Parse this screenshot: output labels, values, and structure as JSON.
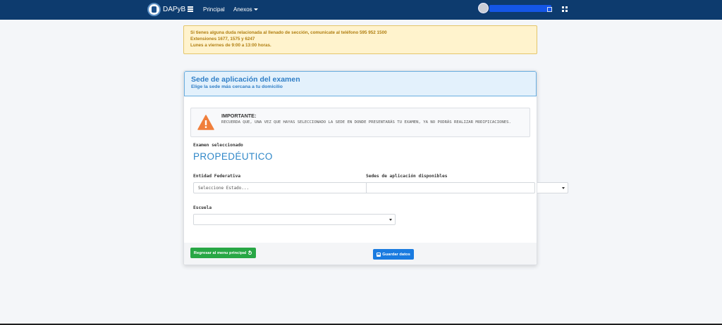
{
  "navbar": {
    "brand": "DAPyB",
    "links": [
      {
        "label": "Principal"
      },
      {
        "label": "Anexos"
      }
    ],
    "icons": {
      "menu": "menu-icon",
      "user": "avatar",
      "expand": "expand-icon",
      "apps": "grid-icon"
    }
  },
  "alert": {
    "line1": "Si tienes alguna duda relacionada al llenado de sección, comunicate al teléfono 595 952 1500",
    "line2": "Extensiones 1677, 1575 y 6247",
    "line3": "Lunes a viernes de 9:00 a 13:00 horas."
  },
  "card": {
    "title": "Sede de aplicación del examen",
    "subtitle": "Elige la sede más cercana a tu domicilio",
    "important": {
      "title": "IMPORTANTE:",
      "text": "RECUERDA QUE, UNA VEZ QUE HAYAS SELECCIONADO LA SEDE EN DONDE PRESENTARÁS TU EXAMEN, YA NO PODRÁS REALIZAR MODIFICACIONES."
    },
    "exam": {
      "label": "Examen seleccionado",
      "value": "PROPEDÉUTICO"
    },
    "form": {
      "entidad_label": "Entidad Federativa",
      "entidad_value": "Seleccione Estado...",
      "sedes_label": "Sedes de aplicación disponibles",
      "sedes_value": "",
      "escuela_label": "Escuela",
      "escuela_value": ""
    },
    "buttons": {
      "back": "Regresar al menu principal",
      "save": "Guardar datos"
    }
  },
  "colors": {
    "navbar": "#0d3b6e",
    "header_accent": "#2f7ec6",
    "alert_text": "#b07e10",
    "back_button": "#28a745",
    "save_button": "#1a7be0",
    "warning": "#f07f3c"
  }
}
